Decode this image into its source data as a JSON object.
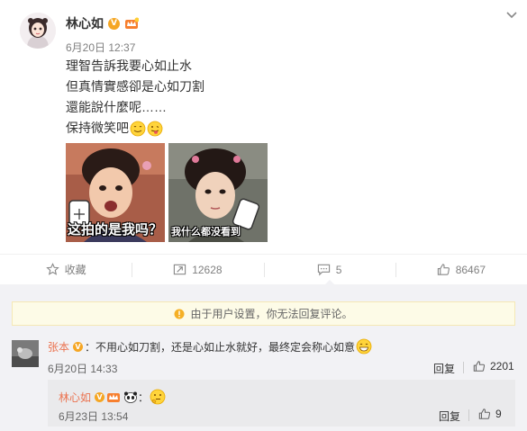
{
  "post": {
    "author": "林心如",
    "time": "6月20日 12:37",
    "lines": [
      "理智告訴我要心如止水",
      "但真情實感卻是心如刀割",
      "還能說什麼呢……",
      "保持微笑吧"
    ],
    "images": [
      {
        "caption": "这拍的是我吗？"
      },
      {
        "caption": "我什么都没看到"
      }
    ]
  },
  "actions": [
    {
      "icon": "star-icon",
      "label": "收藏"
    },
    {
      "icon": "repost-icon",
      "label": "12628"
    },
    {
      "icon": "comment-icon",
      "label": "5"
    },
    {
      "icon": "thumbs-up-icon",
      "label": "86467"
    }
  ],
  "comments": {
    "notice": "由于用户设置，你无法回复评论。",
    "items": [
      {
        "user": "张本",
        "text": "：不用心如刀割，还是心如止水就好，最终定会称心如意",
        "time": "6月20日 14:33",
        "reply_label": "回复",
        "likes": "2201"
      }
    ],
    "reply": {
      "user": "林心如",
      "text": "：",
      "time": "6月23日 13:54",
      "reply_label": "回复",
      "likes": "9"
    }
  },
  "colors": {
    "accent": "#eb7350",
    "vip_badge": "#f5a623",
    "comment_bg": "#f2f2f5",
    "notice_bg": "#fdfbe7"
  }
}
